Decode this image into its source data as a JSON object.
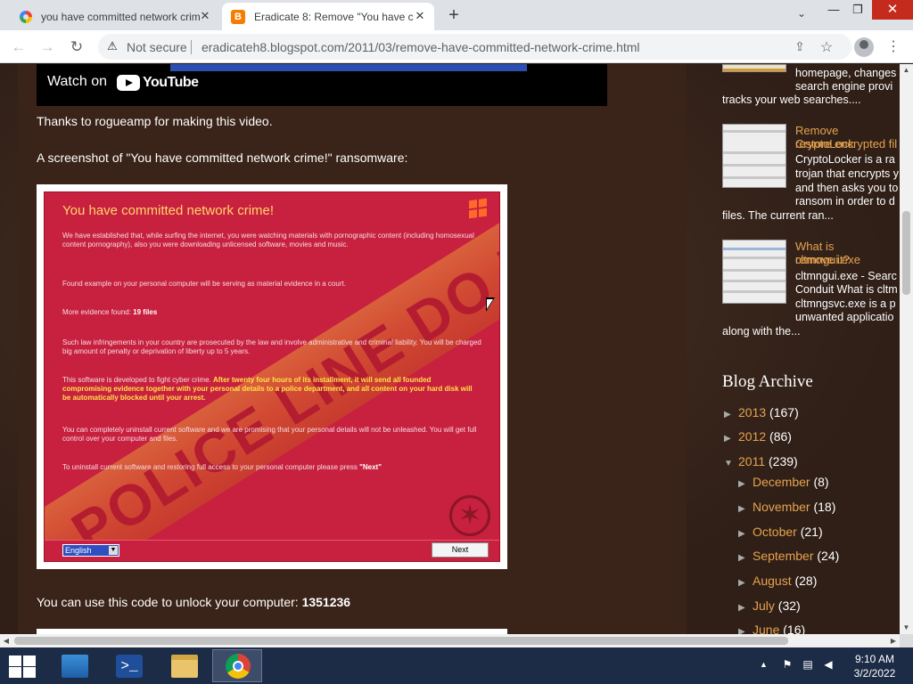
{
  "browser": {
    "tabs": [
      {
        "title": "you have committed network crime",
        "favicon": "google-favicon-icon",
        "active": false
      },
      {
        "title": "Eradicate 8: Remove \"You have committed",
        "favicon": "blogger-favicon-icon",
        "active": true
      }
    ],
    "close_glyph": "✕",
    "new_tab_glyph": "+",
    "security_label": "Not secure",
    "url": "eradicateh8.blogspot.com/2011/03/remove-have-committed-network-crime.html"
  },
  "post": {
    "video_watch_on": "Watch on",
    "video_brand": "YouTube",
    "thanks_text": "Thanks to rogueamp for making this video.",
    "screenshot_caption": "A screenshot of \"You have committed network crime!\" ransomware:",
    "unlock_text_prefix": "You can use this code to unlock your computer:",
    "unlock_code": "1351236"
  },
  "ransomware": {
    "title": "You have committed network crime!",
    "tape_text": "POLICE LINE DO NOT CROSS",
    "paragraphs": {
      "p1": "We have established that, while surfing the internet, you were watching materials with pornographic content (including homosexual content pornography), also you were downloading unlicensed software, movies and music.",
      "p2": "Found example on your personal computer will be serving as material evidence in a court.",
      "p3_prefix": "More evidence found:",
      "p3_value": "19 files",
      "p4": "Such law infringements in your country are prosecuted by the law and involve administrative and criminal liability. You will be charged big amount of penalty or deprivation of liberty up to 5 years.",
      "p5_prefix": "This software is developed to fight cyber crime.",
      "p5_highlight": "After twenty four hours of its installment, it will send all founded compromising evidence together with your personal details to a police department, and all content on your hard disk will be automatically blocked until your arrest.",
      "p6": "You can completely uninstall current software and we are promising that your personal details will not be unleashed. You will get full control over your computer and files.",
      "p7_prefix": "To uninstall current software and restoring full access to your personal computer please press",
      "p7_value": "\"Next\""
    },
    "language": "English",
    "next_label": "Next"
  },
  "sidebar": {
    "popular": [
      {
        "title": "",
        "snippet_lines": [
          "homepage, changes",
          "search engine provi",
          "tracks your web searches...."
        ]
      },
      {
        "title_lines": [
          "Remove CryptoLock",
          "restore encrypted fil"
        ],
        "snippet_lines": [
          "CryptoLocker is a ra",
          "trojan that encrypts y",
          "and then asks you to",
          "ransom in order to d",
          "files. The current ran..."
        ]
      },
      {
        "title_lines": [
          "What is cltmngui.exe",
          "remove it?"
        ],
        "snippet_lines": [
          "cltmngui.exe - Searc",
          "Conduit What is cltm",
          "cltmngsvc.exe is a p",
          "unwanted applicatio",
          "along with the..."
        ]
      }
    ],
    "archive_heading": "Blog Archive",
    "archive": [
      {
        "year": "2013",
        "count": "(167)",
        "expanded": false
      },
      {
        "year": "2012",
        "count": "(86)",
        "expanded": false
      },
      {
        "year": "2011",
        "count": "(239)",
        "expanded": true
      }
    ],
    "months": [
      {
        "name": "December",
        "count": "(8)"
      },
      {
        "name": "November",
        "count": "(18)"
      },
      {
        "name": "October",
        "count": "(21)"
      },
      {
        "name": "September",
        "count": "(24)"
      },
      {
        "name": "August",
        "count": "(28)"
      },
      {
        "name": "July",
        "count": "(32)"
      },
      {
        "name": "June",
        "count": "(16)"
      }
    ]
  },
  "taskbar": {
    "time": "9:10 AM",
    "date": "3/2/2022"
  },
  "colors": {
    "link": "#e6a34f",
    "ransom_red": "#c8203f",
    "taskbar": "#1c2b46"
  }
}
